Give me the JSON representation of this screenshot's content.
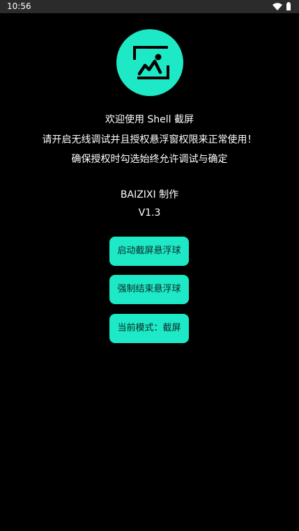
{
  "status_bar": {
    "time": "10:56",
    "icons": [
      "wifi-icon",
      "battery-icon"
    ]
  },
  "logo": {
    "icon": "screenshot-image-icon",
    "color": "#1de9c6"
  },
  "welcome": {
    "line1": "欢迎使用 Shell 截屏",
    "line2": "请开启无线调试并且授权悬浮窗权限来正常使用！",
    "line3": "确保授权时勾选始终允许调试与确定"
  },
  "credits": {
    "author": "BAIZIXI 制作",
    "version": "V1.3"
  },
  "buttons": {
    "start_label": "启动截屏悬浮球",
    "stop_label": "强制结束悬浮球",
    "mode_label": "当前模式：截屏"
  },
  "colors": {
    "accent": "#1de9c6",
    "background": "#000000",
    "status_bar": "#2b2b2b"
  }
}
